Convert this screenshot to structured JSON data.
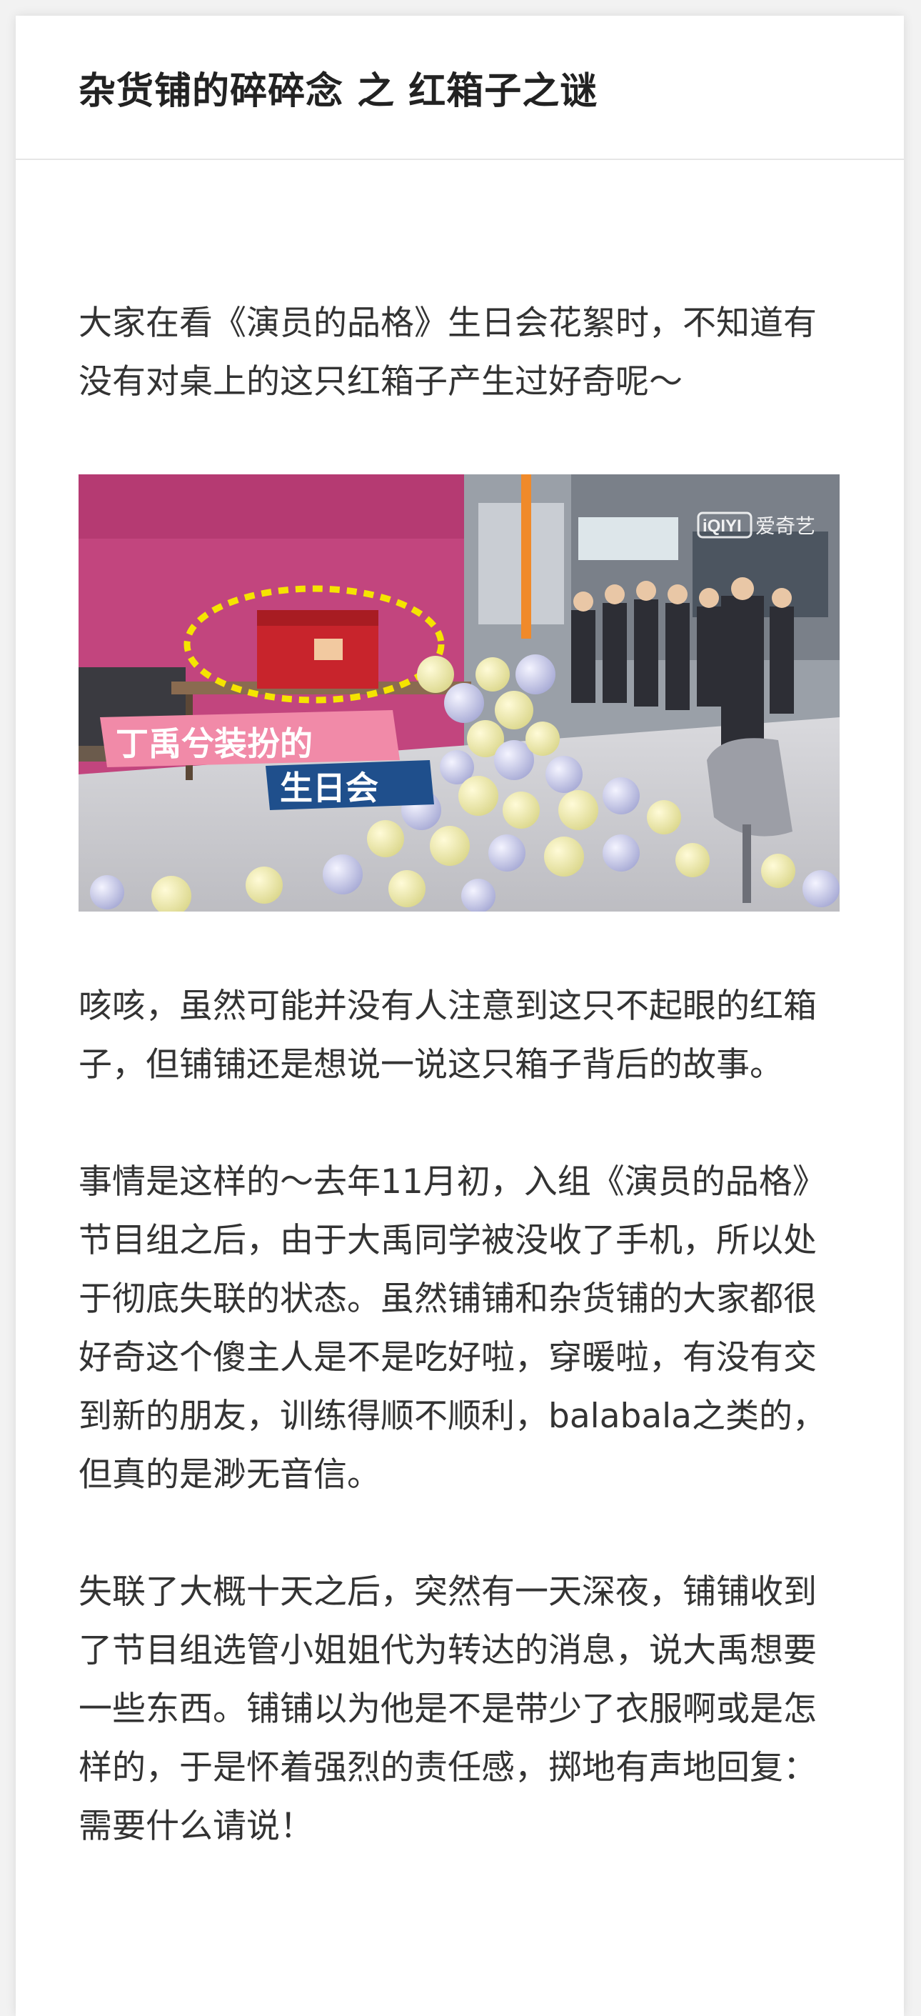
{
  "article": {
    "title": "杂货铺的碎碎念 之 红箱子之谜",
    "paragraphs": [
      "大家在看《演员的品格》生日会花絮时，不知道有没有对桌上的这只红箱子产生过好奇呢～",
      "咳咳，虽然可能并没有人注意到这只不起眼的红箱子，但铺铺还是想说一说这只箱子背后的故事。",
      "事情是这样的～去年11月初，入组《演员的品格》节目组之后，由于大禹同学被没收了手机，所以处于彻底失联的状态。虽然铺铺和杂货铺的大家都很好奇这个傻主人是不是吃好啦，穿暖啦，有没有交到新的朋友，训练得顺不顺利，balabala之类的，但真的是渺无音信。",
      "失联了大概十天之后，突然有一天深夜，铺铺收到了节目组选管小姐姐代为转达的消息，说大禹想要一些东西。铺铺以为他是不是带少了衣服啊或是怎样的，于是怀着强烈的责任感，掷地有声地回复：需要什么请说！"
    ]
  },
  "photo": {
    "caption_line1": "丁禹兮装扮的",
    "caption_line2": "生日会",
    "watermark_logo": "iQIYI",
    "watermark_text": "爱奇艺"
  }
}
